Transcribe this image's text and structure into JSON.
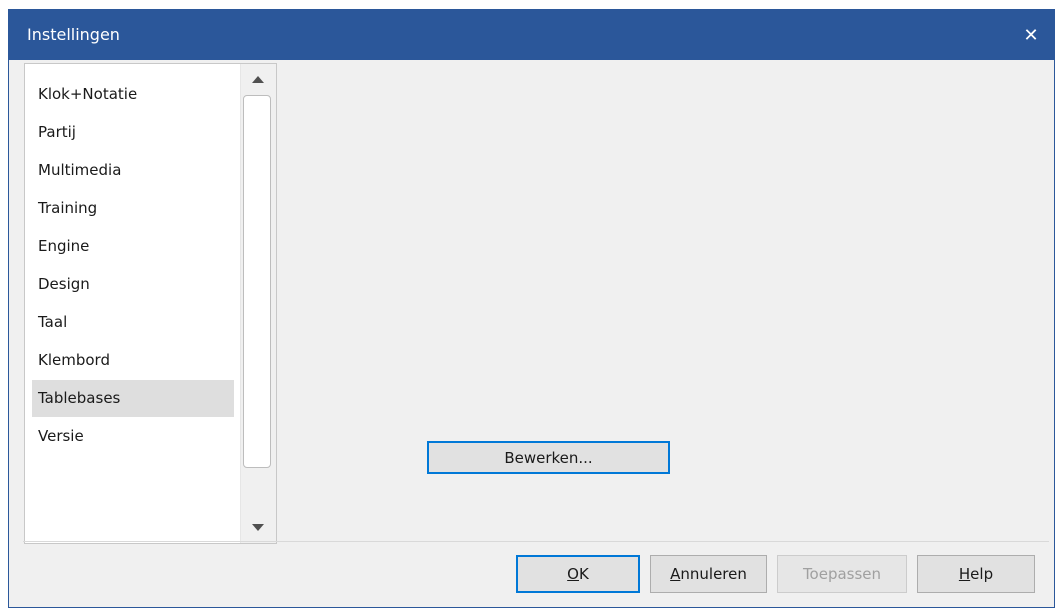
{
  "window": {
    "title": "Instellingen",
    "close_glyph": "✕"
  },
  "nav": {
    "items": [
      {
        "label": "Klok+Notatie"
      },
      {
        "label": "Partij"
      },
      {
        "label": "Multimedia"
      },
      {
        "label": "Training"
      },
      {
        "label": "Engine"
      },
      {
        "label": "Design"
      },
      {
        "label": "Taal"
      },
      {
        "label": "Klembord"
      },
      {
        "label": "Tablebases"
      },
      {
        "label": "Versie"
      }
    ],
    "selected": "Tablebases"
  },
  "panel": {
    "edit_button": "Bewerken..."
  },
  "footer": {
    "ok": {
      "mnemonic": "O",
      "rest": "K"
    },
    "cancel": {
      "mnemonic": "A",
      "rest": "nnuleren"
    },
    "apply": {
      "label": "Toepassen"
    },
    "help": {
      "mnemonic": "H",
      "rest": "elp"
    }
  },
  "colors": {
    "titlebar": "#2b579a",
    "accent": "#0078d7",
    "selection": "#dedede"
  },
  "icons": {
    "close": "close-icon",
    "scroll_up": "scroll-up-icon",
    "scroll_down": "scroll-down-icon"
  }
}
